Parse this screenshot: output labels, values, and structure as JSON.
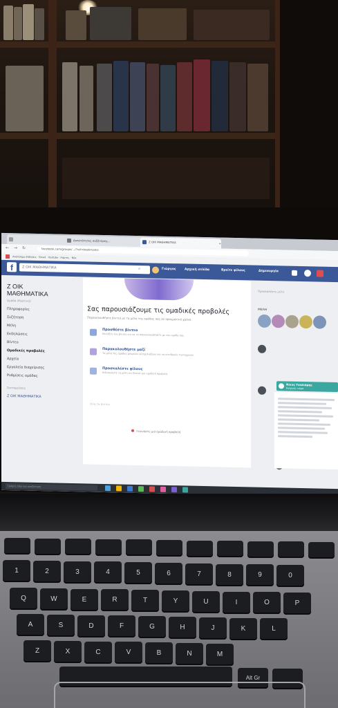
{
  "browser": {
    "tabs": [
      {
        "label": "",
        "active": false
      },
      {
        "label": "Δυνατότητες συζήτησης...",
        "active": false
      },
      {
        "label": "Ζ ΟΙΚ ΜΑΘΗΜΑΤΙΚΑ",
        "active": true
      }
    ],
    "url": "facebook.com/groups/.../?ref=bookmarks",
    "bookmarks": "Ανεπίσημα Ειδήσεις  ·  Gmail  ·  YouTube  ·  Χάρτες  ·  Νέα"
  },
  "facebook": {
    "search_value": "Ζ ΟΙΚ ΜΑΘΗΜΑΤΙΚΑ",
    "nav_links": [
      "Γιώργος",
      "Αρχική σελίδα",
      "Βρείτε φίλους",
      "Δημιουργία"
    ],
    "brand_color": "#3b5998"
  },
  "group": {
    "title_line1": "Ζ ΟΙΚ",
    "title_line2": "ΜΑΘΗΜΑΤΙΚΑ",
    "owner": "Ομάδα (Μυστική)",
    "sidebar_items": [
      "Πληροφορίες",
      "Συζήτηση",
      "Μέλη",
      "Εκδηλώσεις",
      "Βίντεο",
      "Αρχεία"
    ],
    "selected_item": "Ομαδικές προβολές",
    "extra_items": [
      "Εργαλεία διαχείρισης",
      "Ρυθμίσεις ομάδας"
    ],
    "shortcuts_label": "Συντομεύσεις",
    "shortcut": "Ζ ΟΙΚ ΜΑΘΗΜΑΤΙΚΑ"
  },
  "main": {
    "title": "Σας παρουσιάζουμε τις ομαδικές προβολές",
    "subtitle": "Παρακολουθήστε βίντεο με τα μέλη της ομάδας σας σε πραγματικό χρόνο.",
    "suggestions": [
      {
        "title": "Προσθέστε βίντεο",
        "desc": "Επιλέξτε ένα βίντεο για να το παρακολουθήσετε με την ομάδα σας."
      },
      {
        "title": "Παρακολουθήστε μαζί",
        "desc": "Τα μέλη της ομάδας μπορούν να σχολιάζουν και να αντιδρούν ταυτόχρονα."
      },
      {
        "title": "Προσκαλέστε φίλους",
        "desc": "Ειδοποιήστε τα μέλη ότι ξεκινά μια ομαδική προβολή."
      }
    ],
    "more_text": "Όλα τα βίντεο",
    "bottom_link": "Ξεκινήστε μια ομαδική προβολή"
  },
  "right": {
    "header": "Προσκαλέστε μέλη",
    "members_label": "ΜΕΛΗ",
    "chat_name": "Νίκος Τσαλιάρης",
    "chat_status": "Ενεργός τώρα"
  },
  "taskbar": {
    "search_placeholder": "Γράψτε εδώ για αναζήτηση",
    "colors": [
      "#d64f4f",
      "#3a7bd5",
      "#f4b400",
      "#4aa3df",
      "#e05fa0",
      "#5cb85c",
      "#7d5fd4",
      "#3aa8a0"
    ]
  },
  "keyboard": {
    "row1": [
      "1",
      "2",
      "3",
      "4",
      "5",
      "6",
      "7",
      "8",
      "9",
      "0"
    ],
    "row2": [
      "Q",
      "W",
      "E",
      "R",
      "T",
      "Y",
      "U",
      "I",
      "O",
      "P"
    ],
    "row3": [
      "A",
      "S",
      "D",
      "F",
      "G",
      "H",
      "J",
      "K",
      "L"
    ],
    "row4": [
      "Z",
      "X",
      "C",
      "V",
      "B",
      "N",
      "M"
    ],
    "alt_label": "Alt Gr"
  }
}
